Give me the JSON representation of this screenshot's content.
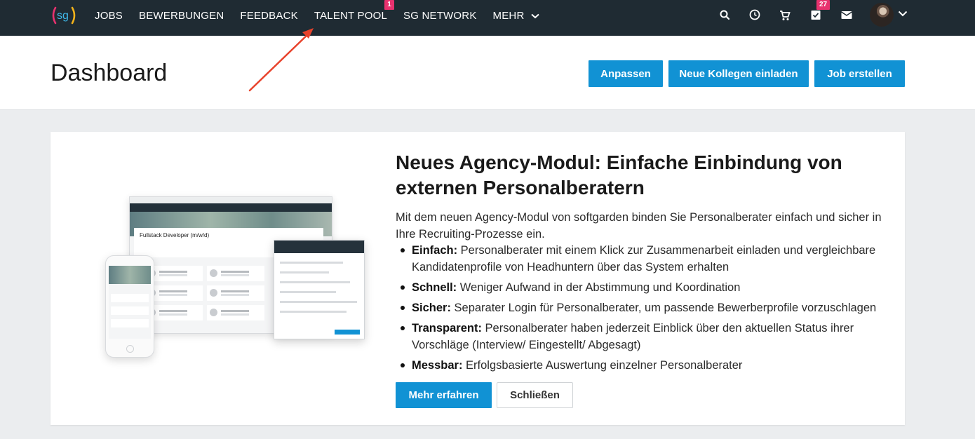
{
  "nav": {
    "logo_text": "sg",
    "items": [
      {
        "label": "JOBS"
      },
      {
        "label": "BEWERBUNGEN"
      },
      {
        "label": "FEEDBACK"
      },
      {
        "label": "TALENT POOL",
        "badge": "1"
      },
      {
        "label": "SG NETWORK"
      },
      {
        "label": "MEHR"
      }
    ],
    "tasks_badge": "27",
    "icons": [
      "search-icon",
      "clock-icon",
      "cart-icon",
      "tasks-icon",
      "mail-icon",
      "avatar",
      "chevron-down-icon"
    ]
  },
  "header": {
    "title": "Dashboard",
    "buttons": {
      "customize": "Anpassen",
      "invite": "Neue Kollegen einladen",
      "create_job": "Job erstellen"
    }
  },
  "card": {
    "title": "Neues Agency-Modul: Einfache Einbindung von externen Personalberatern",
    "intro": "Mit dem neuen Agency-Modul von softgarden binden Sie Personalberater einfach und sicher in Ihre Recruiting-Prozesse ein.",
    "features": [
      {
        "term": "Einfach:",
        "text": " Personalberater mit einem Klick zur Zusammenarbeit einladen und vergleichbare Kandidatenprofile von Headhuntern über das System erhalten"
      },
      {
        "term": "Schnell:",
        "text": " Weniger Aufwand in der Abstimmung und Koordination"
      },
      {
        "term": "Sicher:",
        "text": " Separater Login für Personalberater, um passende Bewerberprofile vorzuschlagen"
      },
      {
        "term": "Transparent:",
        "text": " Personalberater haben jederzeit Einblick über den aktuellen Status ihrer Vorschläge (Interview/ Eingestellt/ Abgesagt)"
      },
      {
        "term": "Messbar:",
        "text": " Erfolgsbasierte Auswertung einzelner Personalberater"
      }
    ],
    "buttons": {
      "learn_more": "Mehr erfahren",
      "close": "Schließen"
    },
    "illustration": {
      "job_title": "Fullstack Developer (m/w/d)"
    }
  },
  "colors": {
    "nav_bg": "#1f2b33",
    "accent": "#1192d4",
    "badge": "#e8326f",
    "annotation_arrow": "#e8432c"
  }
}
